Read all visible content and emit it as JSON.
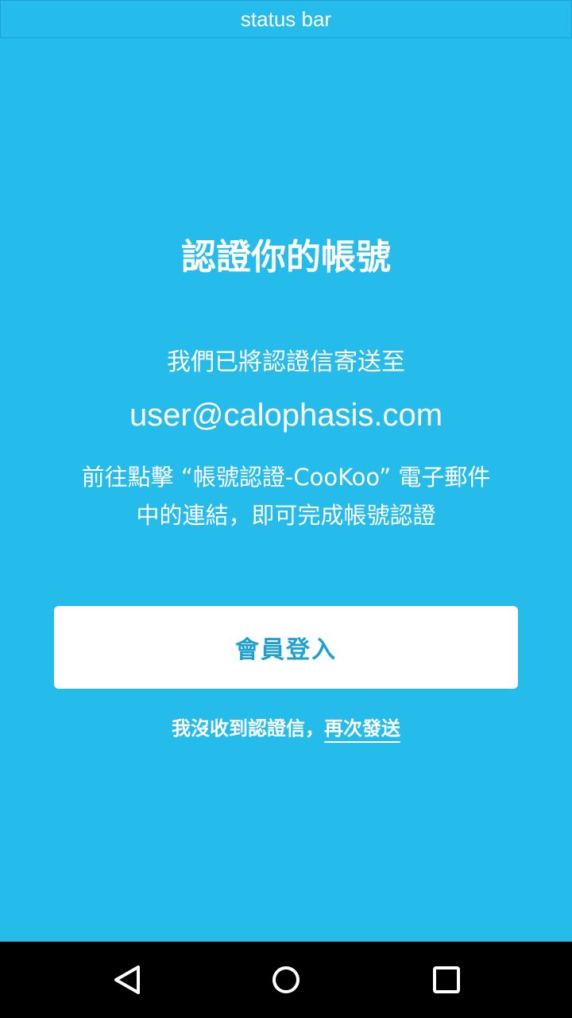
{
  "status_bar": {
    "label": "status bar"
  },
  "main": {
    "title": "認證你的帳號",
    "sent_to_text": "我們已將認證信寄送至",
    "email": "user@calophasis.com",
    "instructions_line1": "前往點擊 “帳號認證-CooKoo” 電子郵件",
    "instructions_line2": "中的連結，即可完成帳號認證",
    "login_button_label": "會員登入",
    "resend_prompt": "我沒收到認證信，",
    "resend_link": "再次發送"
  },
  "colors": {
    "background": "#25bbeb",
    "button_background": "#ffffff",
    "button_text": "#1ea1cf",
    "nav_bar": "#000000"
  },
  "nav_bar": {
    "icons": [
      "back-icon",
      "home-icon",
      "recent-apps-icon"
    ]
  }
}
